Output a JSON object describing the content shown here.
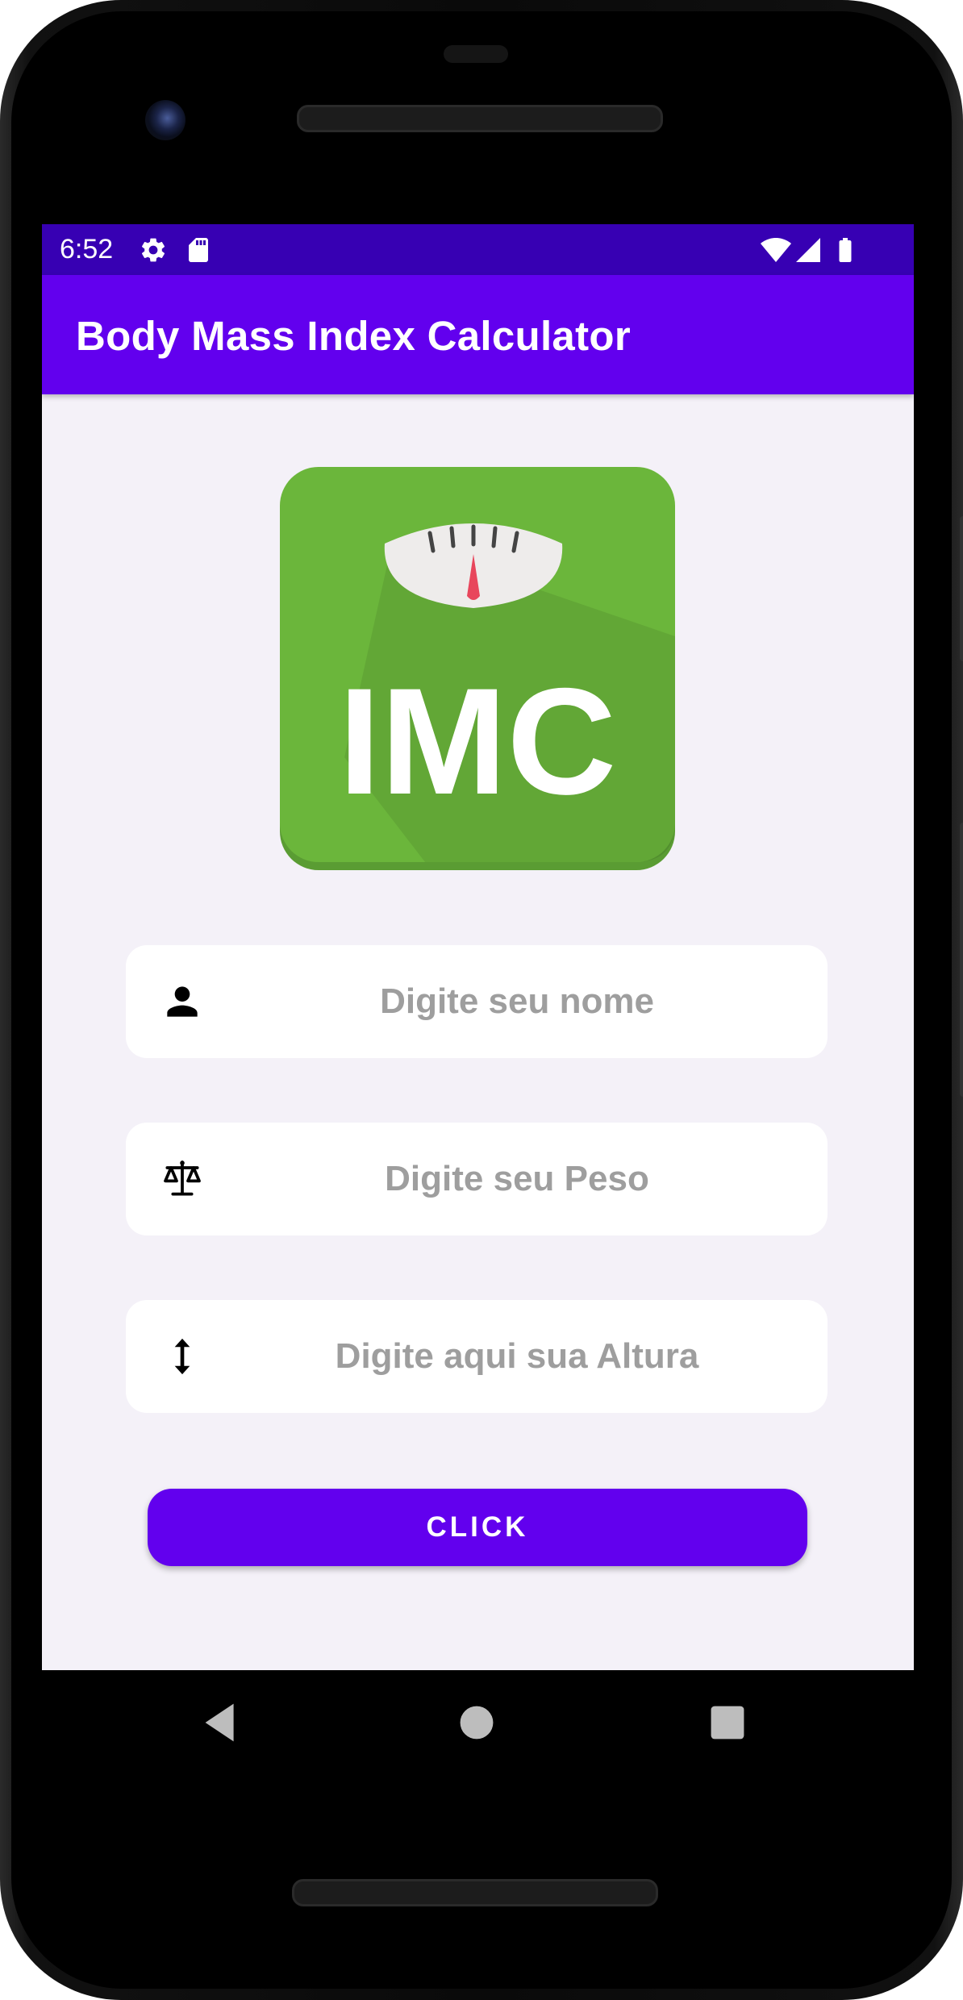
{
  "status_bar": {
    "time": "6:52",
    "left_icons": [
      "settings-icon",
      "sd-card-icon"
    ],
    "right_icons": [
      "wifi-icon",
      "cell-signal-icon",
      "battery-icon"
    ],
    "color": "#3700b3"
  },
  "app_bar": {
    "title": "Body Mass Index Calculator",
    "color": "#6200ee"
  },
  "logo": {
    "text": "IMC",
    "icon": "scale-icon",
    "color": "#6bb63b"
  },
  "form": {
    "name_placeholder": "Digite seu nome",
    "name_icon": "person-icon",
    "weight_placeholder": "Digite seu Peso",
    "weight_icon": "balance-scale-icon",
    "height_placeholder": "Digite aqui sua Altura",
    "height_icon": "vertical-arrows-icon"
  },
  "button": {
    "label": "CLICK",
    "color": "#6200ee"
  },
  "navigation": {
    "back_icon": "back-triangle-icon",
    "home_icon": "home-circle-icon",
    "recents_icon": "recents-square-icon"
  }
}
